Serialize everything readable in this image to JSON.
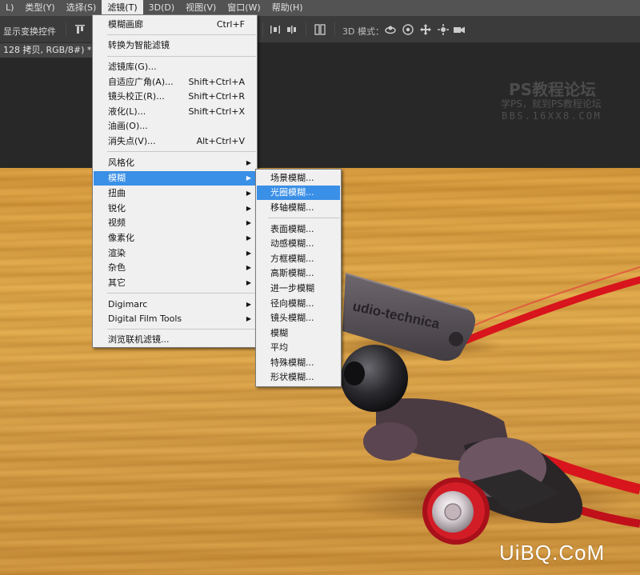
{
  "menubar": {
    "items": [
      {
        "label": "L)"
      },
      {
        "label": "类型(Y)"
      },
      {
        "label": "选择(S)"
      },
      {
        "label": "滤镜(T)"
      },
      {
        "label": "3D(D)"
      },
      {
        "label": "视图(V)"
      },
      {
        "label": "窗口(W)"
      },
      {
        "label": "帮助(H)"
      }
    ],
    "active_index": 3
  },
  "options_bar": {
    "show_transform": "显示变换控件",
    "mode_3d_label": "3D 模式："
  },
  "document_tab": {
    "title": "128 拷贝, RGB/8#) *"
  },
  "canvas": {
    "watermark_title": "PS教程论坛",
    "watermark_sub": "学PS，就到PS教程论坛",
    "watermark_url": "BBS.16XX8.COM",
    "product_brand": "udio-technica",
    "site_watermark": "UiBQ.CoM"
  },
  "filter_menu": {
    "items": [
      {
        "label": "模糊画廊",
        "shortcut": "Ctrl+F"
      },
      {
        "label": "转换为智能滤镜",
        "shortcut": ""
      },
      {
        "label": "滤镜库(G)...",
        "shortcut": ""
      },
      {
        "label": "自适应广角(A)...",
        "shortcut": "Shift+Ctrl+A"
      },
      {
        "label": "镜头校正(R)...",
        "shortcut": "Shift+Ctrl+R"
      },
      {
        "label": "液化(L)...",
        "shortcut": "Shift+Ctrl+X"
      },
      {
        "label": "油画(O)...",
        "shortcut": ""
      },
      {
        "label": "消失点(V)...",
        "shortcut": "Alt+Ctrl+V"
      },
      {
        "label": "风格化",
        "shortcut": ""
      },
      {
        "label": "模糊",
        "shortcut": ""
      },
      {
        "label": "扭曲",
        "shortcut": ""
      },
      {
        "label": "锐化",
        "shortcut": ""
      },
      {
        "label": "视频",
        "shortcut": ""
      },
      {
        "label": "像素化",
        "shortcut": ""
      },
      {
        "label": "渲染",
        "shortcut": ""
      },
      {
        "label": "杂色",
        "shortcut": ""
      },
      {
        "label": "其它",
        "shortcut": ""
      },
      {
        "label": "Digimarc",
        "shortcut": ""
      },
      {
        "label": "Digital Film Tools",
        "shortcut": ""
      },
      {
        "label": "浏览联机滤镜...",
        "shortcut": ""
      }
    ],
    "highlighted": "模糊"
  },
  "blur_submenu": {
    "items": [
      {
        "label": "场景模糊..."
      },
      {
        "label": "光圈模糊..."
      },
      {
        "label": "移轴模糊..."
      },
      {
        "label": "表面模糊..."
      },
      {
        "label": "动感模糊..."
      },
      {
        "label": "方框模糊..."
      },
      {
        "label": "高斯模糊..."
      },
      {
        "label": "进一步模糊"
      },
      {
        "label": "径向模糊..."
      },
      {
        "label": "镜头模糊..."
      },
      {
        "label": "模糊"
      },
      {
        "label": "平均"
      },
      {
        "label": "特殊模糊..."
      },
      {
        "label": "形状模糊..."
      }
    ],
    "highlighted": "光圈模糊..."
  },
  "colors": {
    "highlight": "#3a8fe6",
    "menu_bg": "#f0f0f0",
    "ui_dark": "#282828",
    "earphone_red": "#d8141c"
  }
}
